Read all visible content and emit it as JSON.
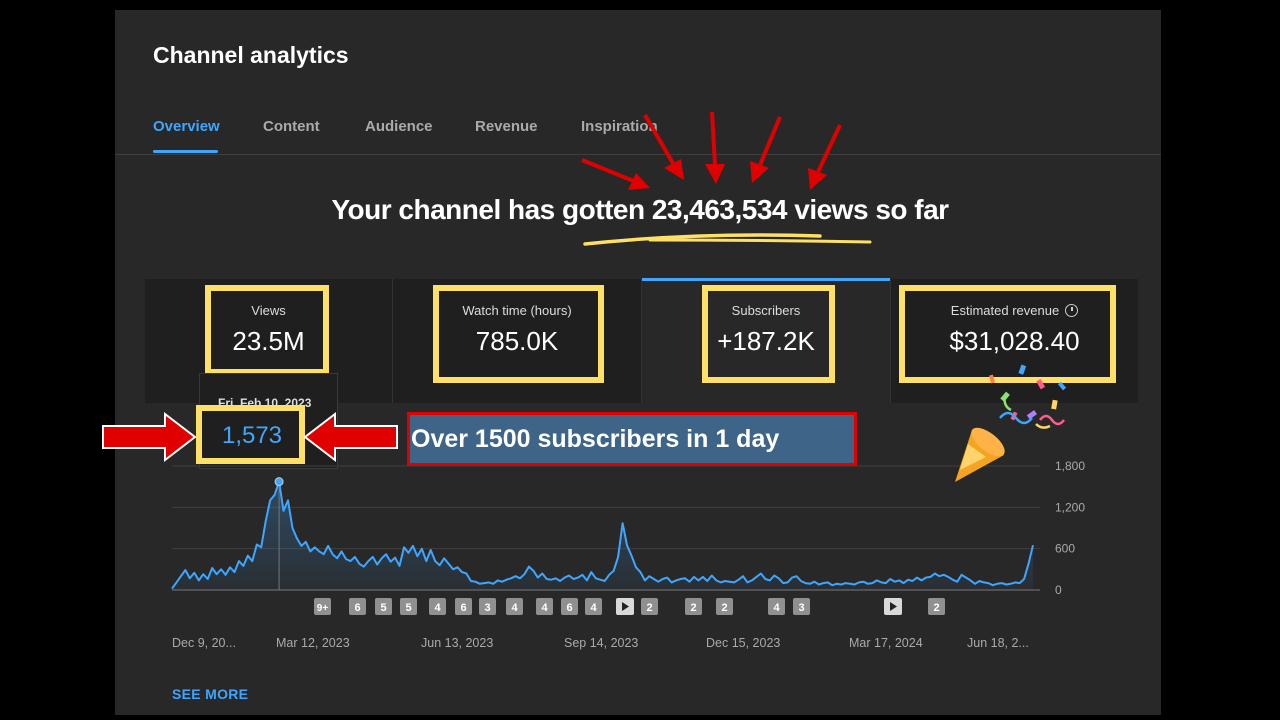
{
  "page": {
    "title": "Channel analytics",
    "tabs": [
      {
        "label": "Overview",
        "active": true
      },
      {
        "label": "Content",
        "active": false
      },
      {
        "label": "Audience",
        "active": false
      },
      {
        "label": "Revenue",
        "active": false
      },
      {
        "label": "Inspiration",
        "active": false
      }
    ],
    "headline": "Your channel has gotten 23,463,534 views so far",
    "see_more": "SEE MORE"
  },
  "metrics": [
    {
      "label": "Views",
      "value": "23.5M"
    },
    {
      "label": "Watch time (hours)",
      "value": "785.0K"
    },
    {
      "label": "Subscribers",
      "value": "+187.2K"
    },
    {
      "label": "Estimated revenue",
      "value": "$31,028.40",
      "icon": "clock-icon"
    }
  ],
  "tooltip": {
    "date": "Fri, Feb 10, 2023",
    "value": "1,573"
  },
  "callout": "Over 1500 subscribers in 1 day",
  "colors": {
    "accent": "#3ea6ff",
    "highlight": "#ffe066",
    "annotation_red": "#e00000",
    "callout_bg": "#3e6588"
  },
  "chart_data": {
    "type": "area",
    "series": [
      {
        "values": [
          20,
          110,
          200,
          290,
          170,
          250,
          140,
          230,
          160,
          320,
          230,
          300,
          220,
          330,
          260,
          420,
          350,
          500,
          420,
          660,
          620,
          1000,
          1300,
          1380,
          1573,
          1150,
          1300,
          900,
          750,
          640,
          700,
          560,
          620,
          560,
          520,
          640,
          520,
          460,
          560,
          450,
          420,
          480,
          380,
          340,
          420,
          480,
          370,
          460,
          520,
          410,
          470,
          350,
          620,
          540,
          640,
          490,
          600,
          420,
          580,
          420,
          360,
          460,
          380,
          300,
          330,
          260,
          240,
          130,
          120,
          90,
          100,
          110,
          90,
          140,
          120,
          150,
          170,
          200,
          170,
          230,
          340,
          280,
          180,
          240,
          160,
          150,
          170,
          130,
          180,
          210,
          160,
          180,
          220,
          140,
          260,
          170,
          150,
          130,
          220,
          280,
          480,
          970,
          650,
          500,
          330,
          260,
          140,
          200,
          160,
          120,
          160,
          180,
          110,
          140,
          160,
          170,
          120,
          190,
          140,
          190,
          130,
          210,
          140,
          110,
          130,
          120,
          110,
          150,
          200,
          110,
          140,
          190,
          240,
          160,
          140,
          210,
          170,
          100,
          110,
          180,
          200,
          130,
          100,
          90,
          120,
          80,
          100,
          110,
          70,
          90,
          80,
          100,
          90,
          80,
          110,
          120,
          90,
          100,
          140,
          110,
          100,
          160,
          120,
          140,
          100,
          150,
          130,
          180,
          140,
          180,
          190,
          240,
          200,
          220,
          190,
          150,
          120,
          220,
          180,
          140,
          90,
          130,
          110,
          100,
          70,
          90,
          100,
          80,
          90,
          110,
          100,
          160,
          380,
          650
        ]
      }
    ],
    "x_tick_labels": [
      "Dec 9, 20...",
      "Mar 12, 2023",
      "Jun 13, 2023",
      "Sep 14, 2023",
      "Dec 15, 2023",
      "Mar 17, 2024",
      "Jun 18, 2..."
    ],
    "y_tick_labels": [
      "1,800",
      "1,200",
      "600",
      "0"
    ],
    "ylim": [
      0,
      1800
    ],
    "peak": {
      "date": "Fri, Feb 10, 2023",
      "value": 1573
    },
    "markers": [
      {
        "label": "9+"
      },
      {
        "label": "6"
      },
      {
        "label": "5"
      },
      {
        "label": "5"
      },
      {
        "label": "4"
      },
      {
        "label": "6"
      },
      {
        "label": "3"
      },
      {
        "label": "4"
      },
      {
        "label": "4"
      },
      {
        "label": "6"
      },
      {
        "label": "4"
      },
      {
        "label": "▶"
      },
      {
        "label": "2"
      },
      {
        "label": "2"
      },
      {
        "label": "2"
      },
      {
        "label": "4"
      },
      {
        "label": "3"
      },
      {
        "label": "▶"
      },
      {
        "label": "2"
      }
    ]
  }
}
